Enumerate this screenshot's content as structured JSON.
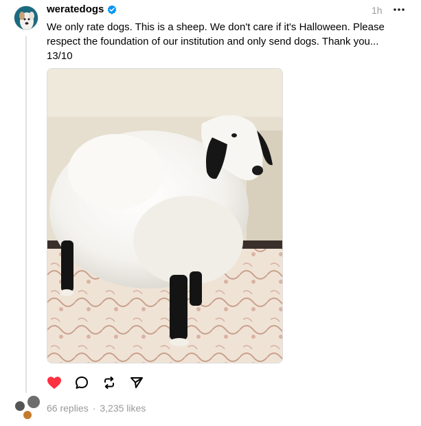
{
  "post": {
    "username": "weratedogs",
    "time": "1h",
    "text_line1": "We only rate dogs. This is a sheep. We don't care if it's Halloween. Please",
    "text_line2": "respect the foundation of our institution and only send dogs. Thank you...",
    "text_line3": "13/10",
    "replies": "66 replies",
    "separator": "·",
    "likes": "3,235 likes"
  },
  "colors": {
    "like_active": "#ff3040",
    "verified": "#0095f6",
    "muted": "#999999"
  },
  "icons": [
    "verified-badge-icon",
    "more-icon",
    "heart-icon",
    "comment-icon",
    "repost-icon",
    "share-icon"
  ]
}
